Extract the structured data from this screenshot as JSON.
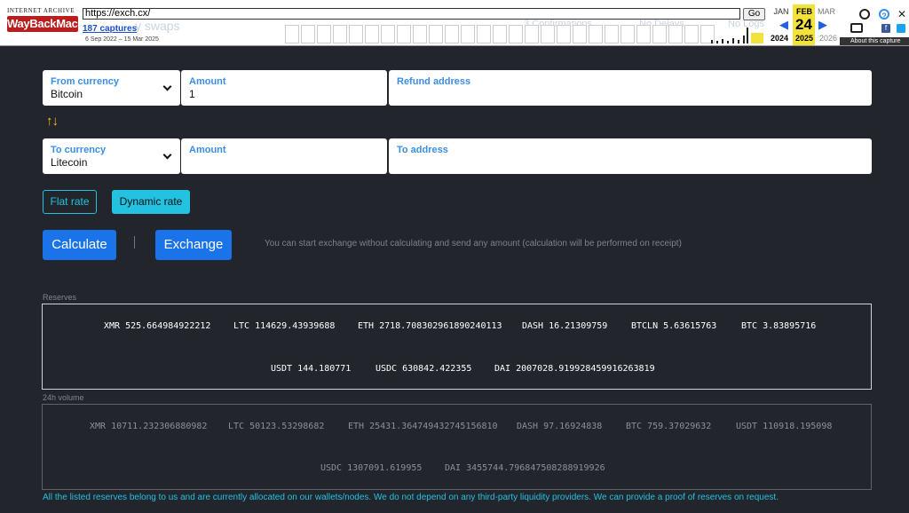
{
  "wayback": {
    "url": "https://exch.cx/",
    "go_label": "Go",
    "captures": "187 captures",
    "range": "6 Sep 2022 – 15 Mar 2025",
    "logo_top": "INTERNET ARCHIVE",
    "logo_main": "WayBackMachine",
    "months": [
      "JAN",
      "FEB",
      "MAR"
    ],
    "day": "24",
    "years": [
      "2024",
      "2025",
      "2026"
    ],
    "about": "About this capture",
    "ghost_texts": [
      "y swaps",
      "3 Confirmations",
      "No Delays",
      "No Logs"
    ]
  },
  "form": {
    "from_currency_label": "From currency",
    "from_currency_value": "Bitcoin",
    "amount_from_label": "Amount",
    "amount_from_value": "1",
    "refund_label": "Refund address",
    "swap_icon": "↑↓",
    "to_currency_label": "To currency",
    "to_currency_value": "Litecoin",
    "amount_to_label": "Amount",
    "to_address_label": "To address",
    "flat_rate": "Flat rate",
    "dynamic_rate": "Dynamic rate",
    "calculate": "Calculate",
    "exchange": "Exchange",
    "hint": "You can start exchange without calculating and send any amount (calculation will be performed on receipt)"
  },
  "reserves": {
    "label": "Reserves",
    "row1": [
      "XMR 525.664984922212",
      "LTC 114629.43939688",
      "ETH 2718.708302961890240113",
      "DASH 16.21309759",
      "BTCLN 5.63615763",
      "BTC 3.83895716"
    ],
    "row2": [
      "USDT 144.180771",
      "USDC 630842.422355",
      "DAI 2007028.919928459916263819"
    ]
  },
  "volume": {
    "label": "24h volume",
    "row1": [
      "XMR 10711.232306880982",
      "LTC 50123.53298682",
      "ETH 25431.364749432745156810",
      "DASH 97.16924838",
      "BTC 759.37029632",
      "USDT 110918.195098"
    ],
    "row2": [
      "USDC 1307091.619955",
      "DAI 3455744.796847508288919926"
    ]
  },
  "note": "All the listed reserves belong to us and are currently allocated on our wallets/nodes. We do not depend on any third-party liquidity providers. We can provide a proof of reserves on request.",
  "colors": {
    "background": "#22252b",
    "accent_blue": "#1a73e8",
    "cyan": "#23c2e0",
    "label_blue": "#3a8ee6",
    "swap_yellow": "#f7c20f"
  }
}
